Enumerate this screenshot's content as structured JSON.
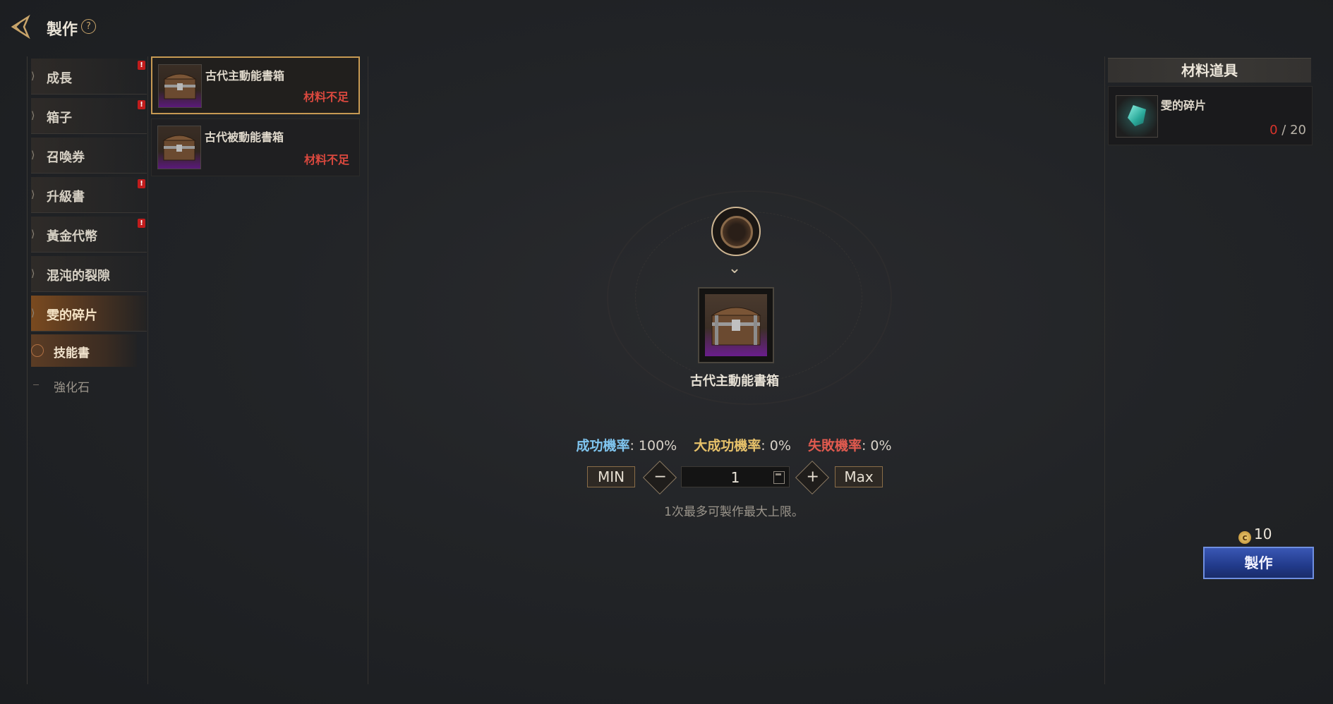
{
  "header": {
    "title": "製作",
    "help_icon": "question-mark-icon",
    "back_icon": "back-arrow-icon"
  },
  "categories": [
    {
      "label": "成長",
      "alert": true,
      "active": false
    },
    {
      "label": "箱子",
      "alert": true,
      "active": false
    },
    {
      "label": "召喚券",
      "alert": false,
      "active": false
    },
    {
      "label": "升級書",
      "alert": true,
      "active": false
    },
    {
      "label": "黃金代幣",
      "alert": true,
      "active": false
    },
    {
      "label": "混沌的裂隙",
      "alert": false,
      "active": false
    },
    {
      "label": "雯的碎片",
      "alert": false,
      "active": true
    }
  ],
  "subcategories": [
    {
      "label": "技能書",
      "active": true
    },
    {
      "label": "強化石",
      "active": false
    }
  ],
  "recipes": [
    {
      "name": "古代主動能書箱",
      "status": "材料不足",
      "selected": true
    },
    {
      "name": "古代被動能書箱",
      "status": "材料不足",
      "selected": false
    }
  ],
  "product": {
    "name": "古代主動能書箱"
  },
  "rates": {
    "success_label": "成功機率",
    "success_value": ": 100%",
    "great_label": "大成功機率",
    "great_value": ": 0%",
    "fail_label": "失敗機率",
    "fail_value": ": 0%",
    "colors": {
      "success": "#7fc4ee",
      "great": "#e6c16a",
      "fail": "#e05a4f"
    }
  },
  "quantity": {
    "min_label": "MIN",
    "max_label": "Max",
    "value": "1",
    "minus": "−",
    "plus": "+"
  },
  "hint": "1次最多可製作最大上限。",
  "materials": {
    "header": "材料道具",
    "items": [
      {
        "name": "雯的碎片",
        "have": "0",
        "separator": " / ",
        "need": "20"
      }
    ]
  },
  "cost": {
    "amount": "10",
    "icon": "gold-coin-icon"
  },
  "craft_button": {
    "label": "製作",
    "color": "#2b4aa5"
  }
}
